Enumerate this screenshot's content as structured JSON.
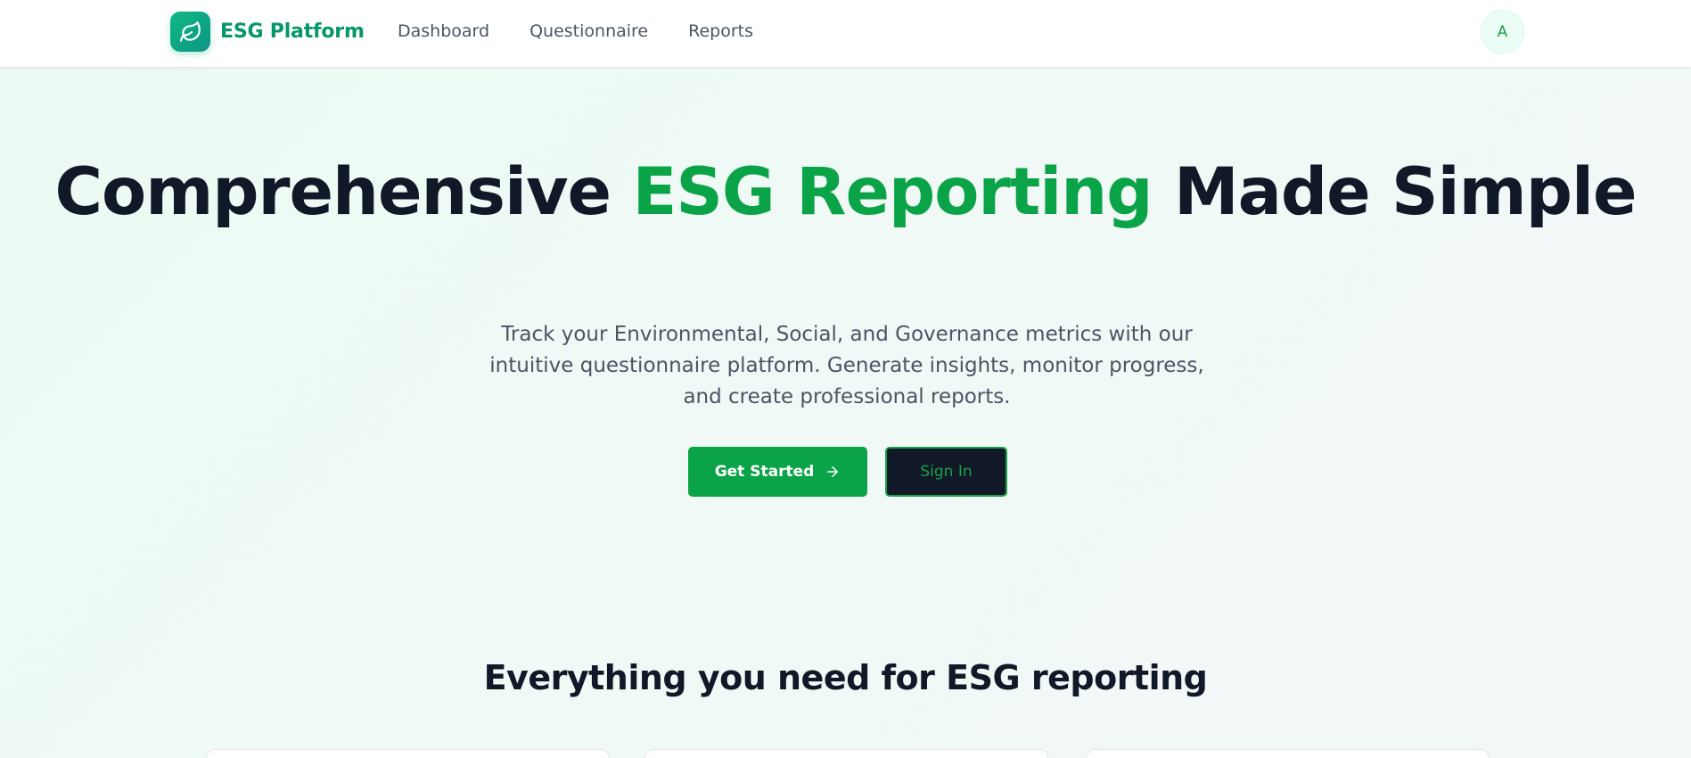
{
  "header": {
    "brand": "ESG Platform",
    "logo_icon": "leaf-icon",
    "nav": [
      {
        "label": "Dashboard"
      },
      {
        "label": "Questionnaire"
      },
      {
        "label": "Reports"
      }
    ],
    "avatar_initial": "A"
  },
  "hero": {
    "title_part1": "Comprehensive ",
    "title_accent": "ESG Reporting",
    "title_part2": " Made Simple",
    "subtitle": "Track your Environmental, Social, and Governance metrics with our intuitive questionnaire platform. Generate insights, monitor progress, and create professional reports.",
    "primary_button": "Get Started",
    "primary_button_icon": "arrow-right-icon",
    "secondary_button": "Sign In"
  },
  "features": {
    "title": "Everything you need for ESG reporting"
  },
  "colors": {
    "accent": "#0ba347",
    "brand": "#059669",
    "dark": "#111827"
  }
}
